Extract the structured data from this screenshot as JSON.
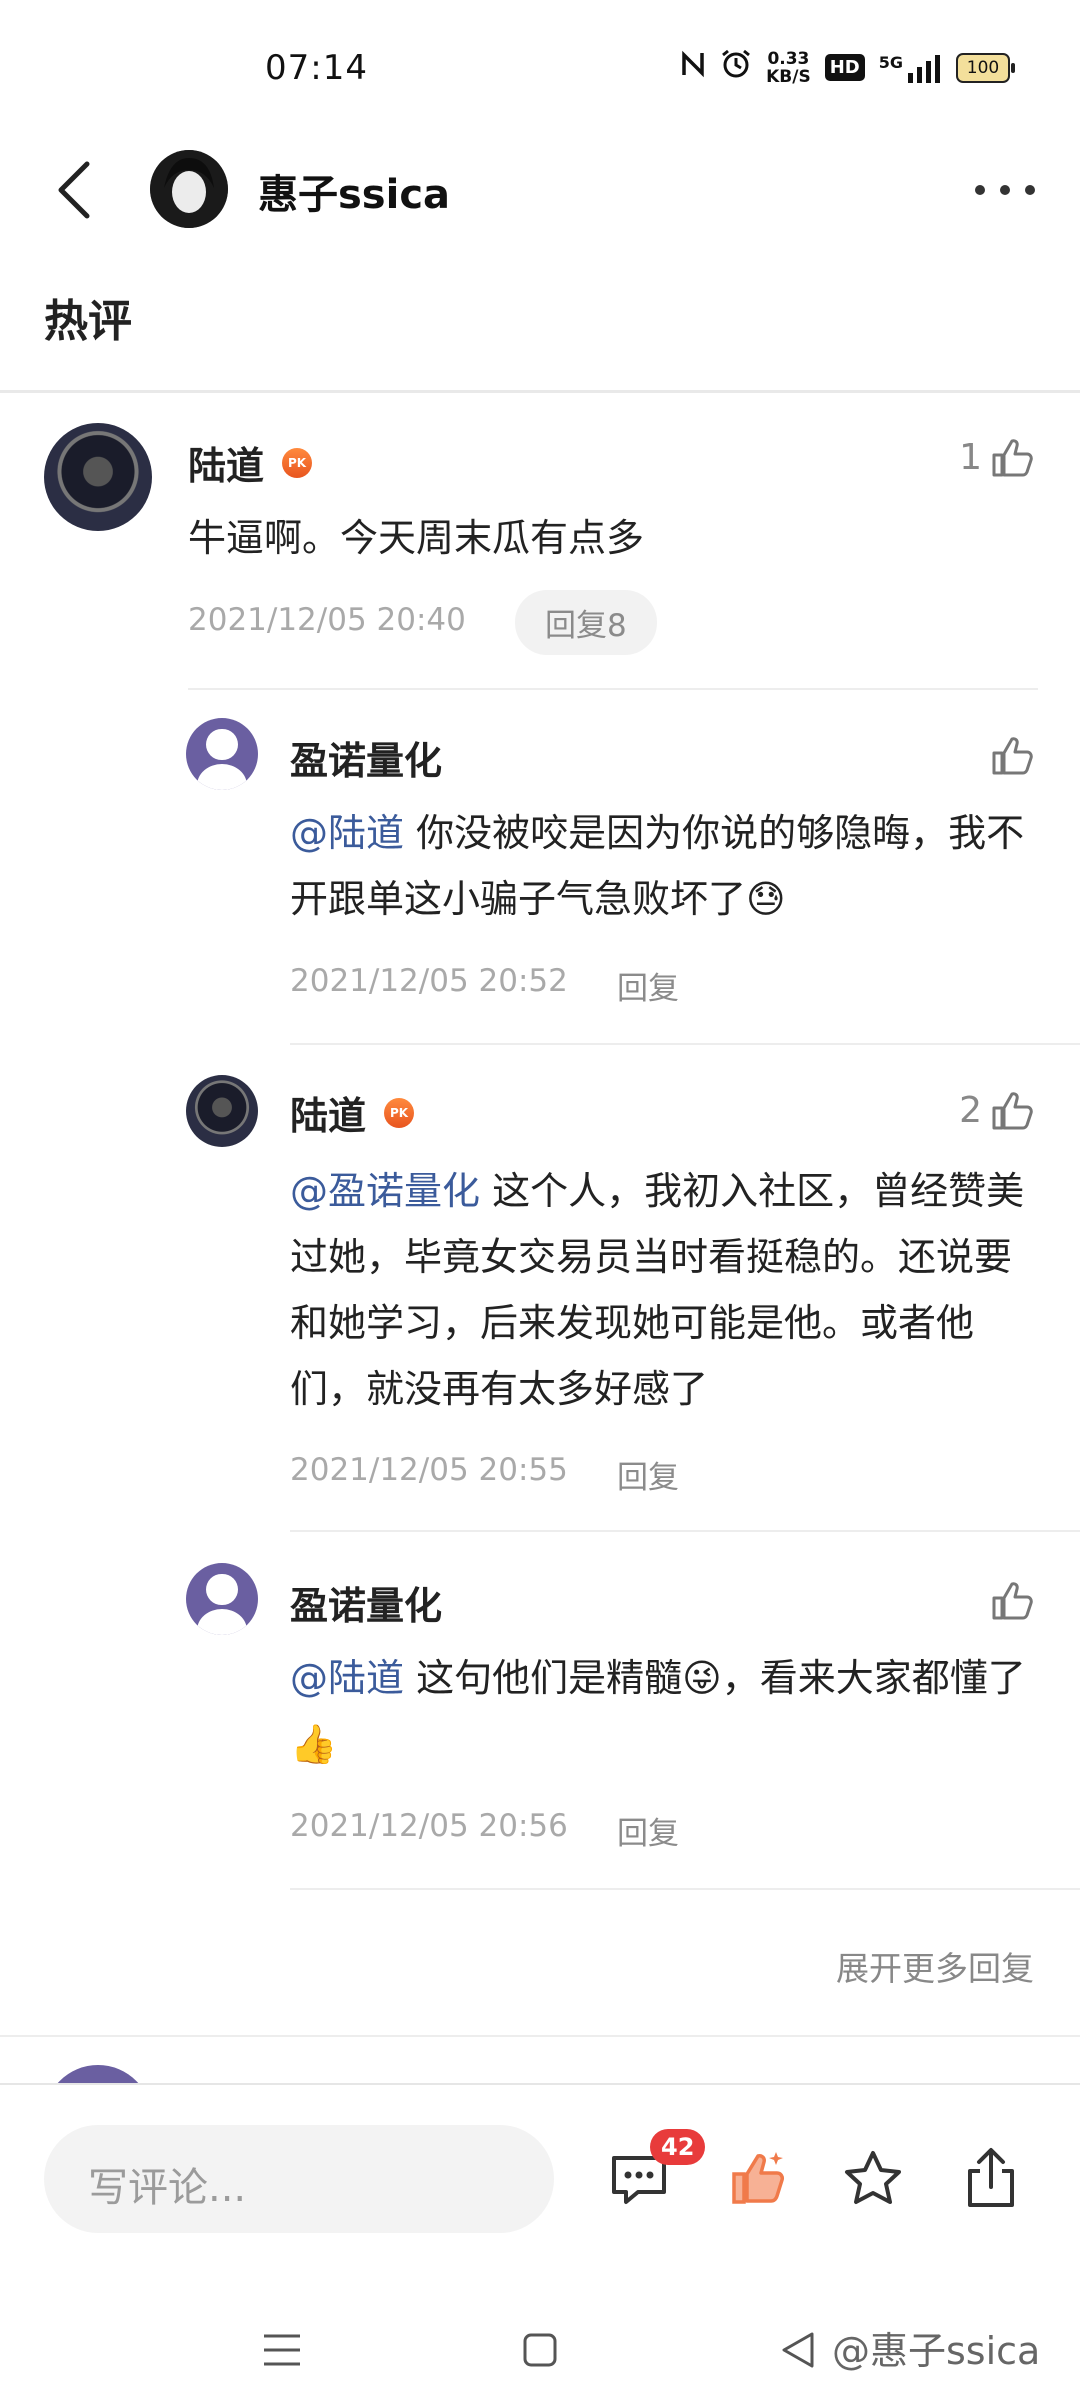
{
  "status_bar": {
    "time": "07:14",
    "net_speed_value": "0.33",
    "net_speed_unit": "KB/S",
    "hd": "HD",
    "signal": "5G",
    "battery": "100"
  },
  "header": {
    "title": "惠子ssica"
  },
  "section_title": "热评",
  "comments": {
    "main": {
      "name": "陆道",
      "likes": "1",
      "text": "牛逼啊。今天周末瓜有点多",
      "time": "2021/12/05 20:40",
      "reply_count": "回复8"
    },
    "replies": [
      {
        "name": "盈诺量化",
        "likes": "",
        "mention": "@陆道",
        "text": " 你没被咬是因为你说的够隐晦，我不开跟单这小骗子气急败坏了😓",
        "time": "2021/12/05 20:52",
        "reply": "回复"
      },
      {
        "name": "陆道",
        "likes": "2",
        "mention": "@盈诺量化",
        "text": " 这个人，我初入社区，曾经赞美过她，毕竟女交易员当时看挺稳的。还说要和她学习，后来发现她可能是他。或者他们，就没再有太多好感了",
        "time": "2021/12/05 20:55",
        "reply": "回复"
      },
      {
        "name": "盈诺量化",
        "likes": "",
        "mention": "@陆道",
        "text": " 这句他们是精髓😜，看来大家都懂了👍",
        "time": "2021/12/05 20:56",
        "reply": "回复"
      }
    ],
    "expand_more": "展开更多回复"
  },
  "bottom_bar": {
    "input_placeholder": "写评论...",
    "comment_badge": "42"
  },
  "nav": {
    "watermark": "@惠子ssica"
  },
  "colors": {
    "mention": "#3b5b9b",
    "like_active": "#f07a4a",
    "badge": "#e83b3b",
    "avatar_purple": "#6a5fa1"
  }
}
